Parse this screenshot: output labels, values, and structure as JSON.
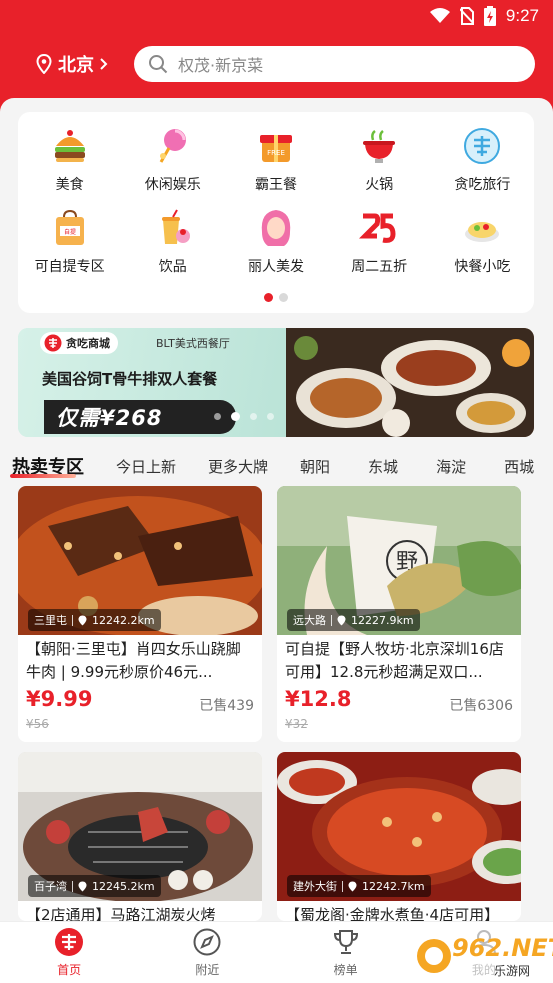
{
  "status_bar": {
    "time": "9:27"
  },
  "header": {
    "city": "北京",
    "search_placeholder": "权茂·新京菜"
  },
  "categories": [
    {
      "label": "美食",
      "icon": "burger-icon"
    },
    {
      "label": "休闲娱乐",
      "icon": "lollipop-icon"
    },
    {
      "label": "霸王餐",
      "icon": "gift-box-icon"
    },
    {
      "label": "火锅",
      "icon": "hotpot-icon"
    },
    {
      "label": "贪吃旅行",
      "icon": "travel-logo-icon"
    },
    {
      "label": "可自提专区",
      "icon": "takeaway-bag-icon"
    },
    {
      "label": "饮品",
      "icon": "drink-icon"
    },
    {
      "label": "丽人美发",
      "icon": "beauty-icon"
    },
    {
      "label": "周二五折",
      "icon": "discount-25-icon"
    },
    {
      "label": "快餐小吃",
      "icon": "fast-food-icon"
    }
  ],
  "banner": {
    "logo_text": "贪吃商城",
    "store": "BLT美式西餐厅",
    "title": "美国谷饲T骨牛排双人套餐",
    "price": "仅需¥268"
  },
  "tabs": [
    "热卖专区",
    "今日上新",
    "更多大牌",
    "朝阳",
    "东城",
    "海淀",
    "西城"
  ],
  "products": [
    {
      "area": "三里屯",
      "distance": "12242.2km",
      "title": "【朝阳·三里屯】肖四女乐山跷脚牛肉 | 9.99元秒原价46元...",
      "price": "¥9.99",
      "original": "¥56",
      "sold": "已售439"
    },
    {
      "area": "远大路",
      "distance": "12227.9km",
      "title": "可自提【野人牧坊·北京深圳16店可用】12.8元秒超满足双口...",
      "price": "¥12.8",
      "original": "¥32",
      "sold": "已售6306"
    },
    {
      "area": "百子湾",
      "distance": "12245.2km",
      "title": "【2店通用】马路江湖炭火烤",
      "price": "",
      "original": "",
      "sold": ""
    },
    {
      "area": "建外大街",
      "distance": "12242.7km",
      "title": "【蜀龙阁·金牌水煮鱼·4店可用】",
      "price": "",
      "original": "",
      "sold": ""
    }
  ],
  "bottom_nav": [
    {
      "label": "首页",
      "icon": "home-logo-icon"
    },
    {
      "label": "附近",
      "icon": "compass-icon"
    },
    {
      "label": "榜单",
      "icon": "trophy-icon"
    },
    {
      "label": "我的",
      "icon": "user-icon"
    }
  ],
  "watermark": {
    "text": "962.NET",
    "sub": "乐游网"
  },
  "colors": {
    "brand_red": "#e8212a"
  }
}
